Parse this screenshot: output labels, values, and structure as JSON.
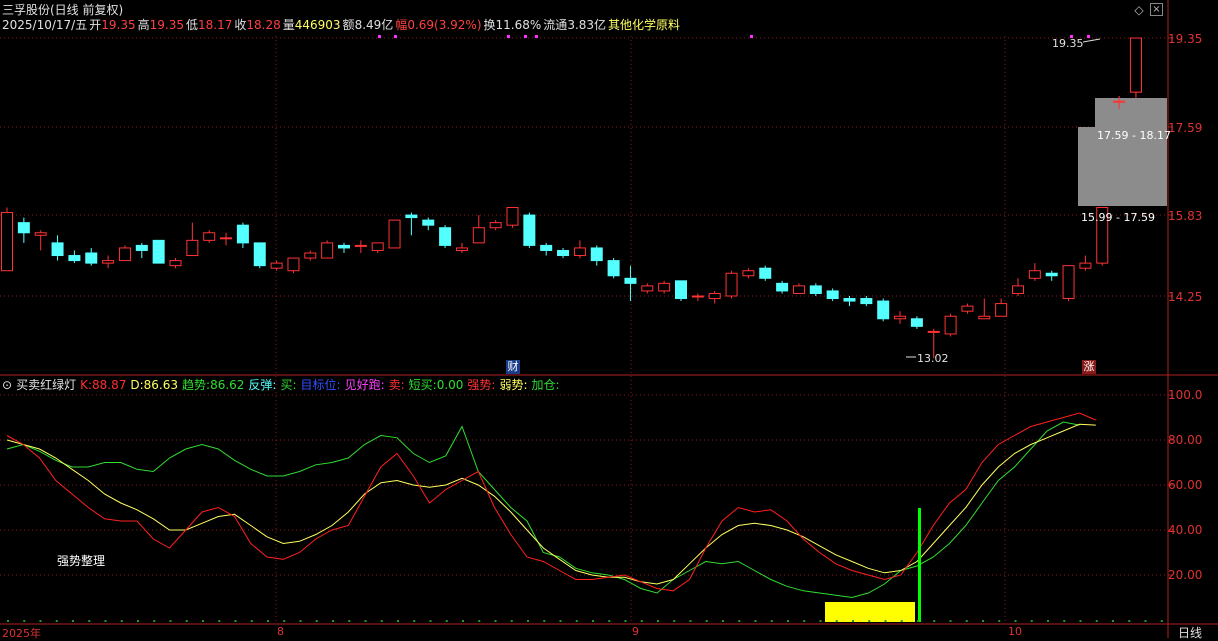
{
  "window": {
    "title": "三孚股份(日线 前复权)",
    "collapse_icon": "diamond-icon",
    "close_icon": "close-box-icon"
  },
  "quote": {
    "date": "2025/10/17/五",
    "open_label": "开",
    "open": "19.35",
    "high_label": "高",
    "high": "19.35",
    "low_label": "低",
    "low": "18.17",
    "close_label": "收",
    "close": "18.28",
    "volume_label": "量",
    "volume": "446903",
    "amount_label": "额",
    "amount": "8.49亿",
    "change_label": "幅",
    "change": "0.69(3.92%)",
    "turnover_label": "换",
    "turnover": "11.68%",
    "float_label": "流通",
    "float": "3.83亿",
    "industry": "其他化学原料"
  },
  "price_axis": [
    "19.35",
    "17.59",
    "15.83",
    "14.25"
  ],
  "price_labels": {
    "high_mark": "19.35",
    "low_mark": "13.02",
    "zone_upper": "17.59 - 18.17",
    "zone_lower": "15.99 - 17.59",
    "fin_badge": "财",
    "up_badge": "涨"
  },
  "indicator": {
    "name": "买卖红绿灯",
    "k_label": "K:",
    "k_value": "88.87",
    "d_label": "D:",
    "d_value": "86.63",
    "trend_label": "趋势:",
    "trend_value": "86.62",
    "rebound_label": "反弹:",
    "buy_label": "买:",
    "target_label": "目标位:",
    "take_label": "见好跑:",
    "sell_label": "卖:",
    "short_buy_label": "短买:",
    "short_buy_value": "0.00",
    "strong_label": "强势:",
    "weak_label": "弱势:",
    "add_label": "加仓:",
    "note": "强势整理",
    "axis": [
      "100.0",
      "80.00",
      "60.00",
      "40.00",
      "20.00"
    ]
  },
  "time_axis": {
    "labels": [
      "2025年",
      "8",
      "9",
      "10"
    ],
    "period": "日线"
  },
  "colors": {
    "up": "#ff3333",
    "down": "#54ffff",
    "k_line": "#ff2020",
    "d_line": "#ffff60",
    "trend_line": "#30dd30",
    "grid": "#8b1a1a",
    "yellow_block": "#ffff00",
    "green_bar": "#00ff00"
  }
}
